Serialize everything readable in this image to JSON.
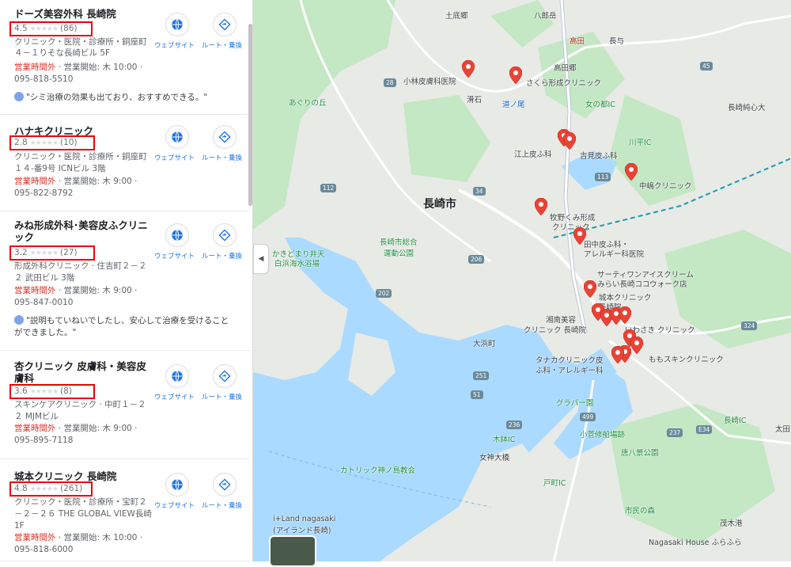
{
  "actions": {
    "website": "ウェブサイト",
    "route": "ルート・乗換"
  },
  "results": [
    {
      "name": "ドーズ美容外科 長崎院",
      "rating": "4.5",
      "count": "(86)",
      "stars": 4.5,
      "line1": "クリニック・医院・診療所・銅座町",
      "line2": "４－１りそな長崎ビル 5F",
      "status_closed": "営業時間外",
      "status_open": " · 営業開始: 木 10:00 ·",
      "phone": "095-818-5510",
      "review": "\"シミ治療の効果も出ており、おすすめできる。\""
    },
    {
      "name": "ハナキクリニック",
      "rating": "2.8",
      "count": "(10)",
      "stars": 2.8,
      "line1": "クリニック・医院・診療所・銅座町",
      "line2": "１４-番9号 ICNビル 3階",
      "status_closed": "営業時間外",
      "status_open": " · 営業開始: 木 9:00 ·",
      "phone": "095-822-8792",
      "review": ""
    },
    {
      "name": "みね形成外科･美容皮ふクリニック",
      "rating": "3.2",
      "count": "(27)",
      "stars": 3.2,
      "line1": "形成外科クリニック · 住吉町２－２",
      "line2": "２ 武田ビル 3階",
      "status_closed": "営業時間外",
      "status_open": " · 営業開始: 木 9:00 ·",
      "phone": "095-847-0010",
      "review": "\"説明もていねいでしたし、安心して治療を受けることができました。\""
    },
    {
      "name": "杏クリニック 皮膚科・美容皮膚科",
      "rating": "3.6",
      "count": "(8)",
      "stars": 3.6,
      "line1": "スキンケアクリニック · 中町１－２",
      "line2": "２ MJMビル",
      "status_closed": "営業時間外",
      "status_open": " · 営業開始: 木 9:00 ·",
      "phone": "095-895-7118",
      "review": ""
    },
    {
      "name": "城本クリニック 長崎院",
      "rating": "4.8",
      "count": "(261)",
      "stars": 4.8,
      "line1": "クリニック・医院・診療所・宝町２",
      "line2": "－２－２６ THE GLOBAL VIEW長崎",
      "line3": "1F",
      "status_closed": "営業時間外",
      "status_open": " · 営業開始: 木 10:00 ·",
      "phone": "095-818-6000",
      "review": ""
    }
  ],
  "map": {
    "city": "長崎市",
    "labels": {
      "dobaru": "土底郷",
      "hatchiguri": "八郎岳",
      "nagayo": "長与",
      "takata": "高田",
      "takadago": "高田郷",
      "kobayashi": "小林皮膚科医院",
      "sakura": "さくら形成クリニック",
      "nameshi": "滑石",
      "michinoo": "道ノ尾",
      "onnanotoge": "女の都IC",
      "kawahira": "川平IC",
      "nagasakijunshi": "長崎純心大",
      "agurinooka": "あぐりの丘",
      "egami": "江上皮ふ科",
      "yoshimi": "吉見皮ふ科",
      "nakajima": "中嶋クリニック",
      "kuroshima": "長崎市総合",
      "kuroshima2": "運動公園",
      "makino": "牧野くみ形成",
      "makino2": "クリニック",
      "tanaka": "田中皮ふ科・",
      "tanaka2": "アレルギー科医院",
      "kakidomari": "かきどまり井天",
      "kakidomari2": "白浜海水浴場",
      "br": "サーティワンアイスクリーム",
      "br2": "みらい長崎ココウォーク店",
      "shiromoto": "城本クリニック",
      "shiromoto2": "長崎院",
      "shonan": "湘南美容",
      "shonan2": "クリニック 長崎院",
      "iwasaki": "いわさき クリニック",
      "omura": "大浜町",
      "tanaka_c": "タナカクリニック皮",
      "tanaka_c2": "ふ科・アレルギー科",
      "momo": "ももスキンクリニック",
      "glover": "グラバー園",
      "kosuge": "小菅修船場跡",
      "kibachi": "木鉢IC",
      "megami": "女神大橋",
      "tojinbo": "唐八景公園",
      "catholic": "カトリック神ノ島教会",
      "tobe": "戸町IC",
      "shiminnomori": "市民の森",
      "ilandn": "i+Land nagasaki",
      "ilandn2": "(アイランド長崎)",
      "moki": "茂木港",
      "nagasakihouse": "Nagasaki House ふらふら",
      "tatai": "太田",
      "nagasaki_ic": "長崎IC",
      "r28": "28",
      "r112": "112",
      "r202": "202",
      "r206": "206",
      "r34": "34",
      "r499": "499",
      "r236": "236",
      "r237": "237",
      "r251": "251",
      "r113": "113",
      "r45": "45",
      "r51": "51",
      "r324": "324",
      "e34": "E34"
    }
  },
  "colors": {
    "water": "#aadaff",
    "land": "#e8eae6",
    "green": "#c4e7c4",
    "road": "#ffffff",
    "pin": "#ea4335"
  }
}
